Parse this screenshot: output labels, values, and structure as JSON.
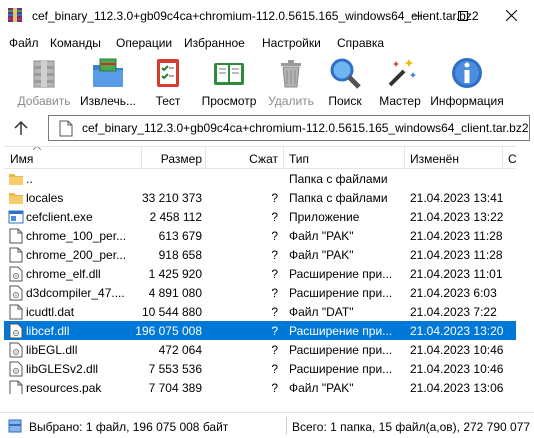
{
  "window": {
    "title": "cef_binary_112.3.0+gb09c4ca+chromium-112.0.5615.165_windows64_client.tar.bz2",
    "minimize_glyph": "—",
    "maximize_glyph": "☐",
    "close_glyph": "✕"
  },
  "menu": [
    "Файл",
    "Команды",
    "Операции",
    "Избранное",
    "Настройки",
    "Справка"
  ],
  "toolbar": {
    "add": "Добавить",
    "extract": "Извлечь...",
    "test": "Тест",
    "view": "Просмотр",
    "delete": "Удалить",
    "find": "Поиск",
    "wizard": "Мастер",
    "info": "Информация"
  },
  "address": {
    "path": "cef_binary_112.3.0+gb09c4ca+chromium-112.0.5615.165_windows64_client.tar.bz2"
  },
  "columns": {
    "name": "Имя",
    "size": "Размер",
    "packed": "Сжат",
    "type": "Тип",
    "modified": "Изменён",
    "crc": "C"
  },
  "files": [
    {
      "name": "..",
      "size": "",
      "packed": "",
      "type": "Папка с файлами",
      "modified": "",
      "icon": "folder-up-icon"
    },
    {
      "name": "locales",
      "size": "33 210 373",
      "packed": "?",
      "type": "Папка с файлами",
      "modified": "21.04.2023 13:41",
      "icon": "folder-icon"
    },
    {
      "name": "cefclient.exe",
      "size": "2 458 112",
      "packed": "?",
      "type": "Приложение",
      "modified": "21.04.2023 13:22",
      "icon": "exe-icon"
    },
    {
      "name": "chrome_100_per...",
      "size": "613 679",
      "packed": "?",
      "type": "Файл \"PAK\"",
      "modified": "21.04.2023 11:28",
      "icon": "file-icon"
    },
    {
      "name": "chrome_200_per...",
      "size": "918 658",
      "packed": "?",
      "type": "Файл \"PAK\"",
      "modified": "21.04.2023 11:28",
      "icon": "file-icon"
    },
    {
      "name": "chrome_elf.dll",
      "size": "1 425 920",
      "packed": "?",
      "type": "Расширение при...",
      "modified": "21.04.2023 11:01",
      "icon": "dll-icon"
    },
    {
      "name": "d3dcompiler_47....",
      "size": "4 891 080",
      "packed": "?",
      "type": "Расширение при...",
      "modified": "21.04.2023 6:03",
      "icon": "dll-icon"
    },
    {
      "name": "icudtl.dat",
      "size": "10 544 880",
      "packed": "?",
      "type": "Файл \"DAT\"",
      "modified": "21.04.2023 7:22",
      "icon": "file-icon"
    },
    {
      "name": "libcef.dll",
      "size": "196 075 008",
      "packed": "?",
      "type": "Расширение при...",
      "modified": "21.04.2023 13:20",
      "icon": "dll-icon",
      "selected": true
    },
    {
      "name": "libEGL.dll",
      "size": "472 064",
      "packed": "?",
      "type": "Расширение при...",
      "modified": "21.04.2023 10:46",
      "icon": "dll-icon"
    },
    {
      "name": "libGLESv2.dll",
      "size": "7 553 536",
      "packed": "?",
      "type": "Расширение при...",
      "modified": "21.04.2023 10:46",
      "icon": "dll-icon"
    },
    {
      "name": "resources.pak",
      "size": "7 704 389",
      "packed": "?",
      "type": "Файл \"PAK\"",
      "modified": "21.04.2023 13:06",
      "icon": "file-icon"
    }
  ],
  "status": {
    "left": "Выбрано: 1 файл, 196 075 008 байт",
    "right": "Всего: 1 папка, 15 файл(а,ов), 272 790 077"
  },
  "colors": {
    "selection": "#0078d7",
    "folder": "#e8b84a"
  }
}
